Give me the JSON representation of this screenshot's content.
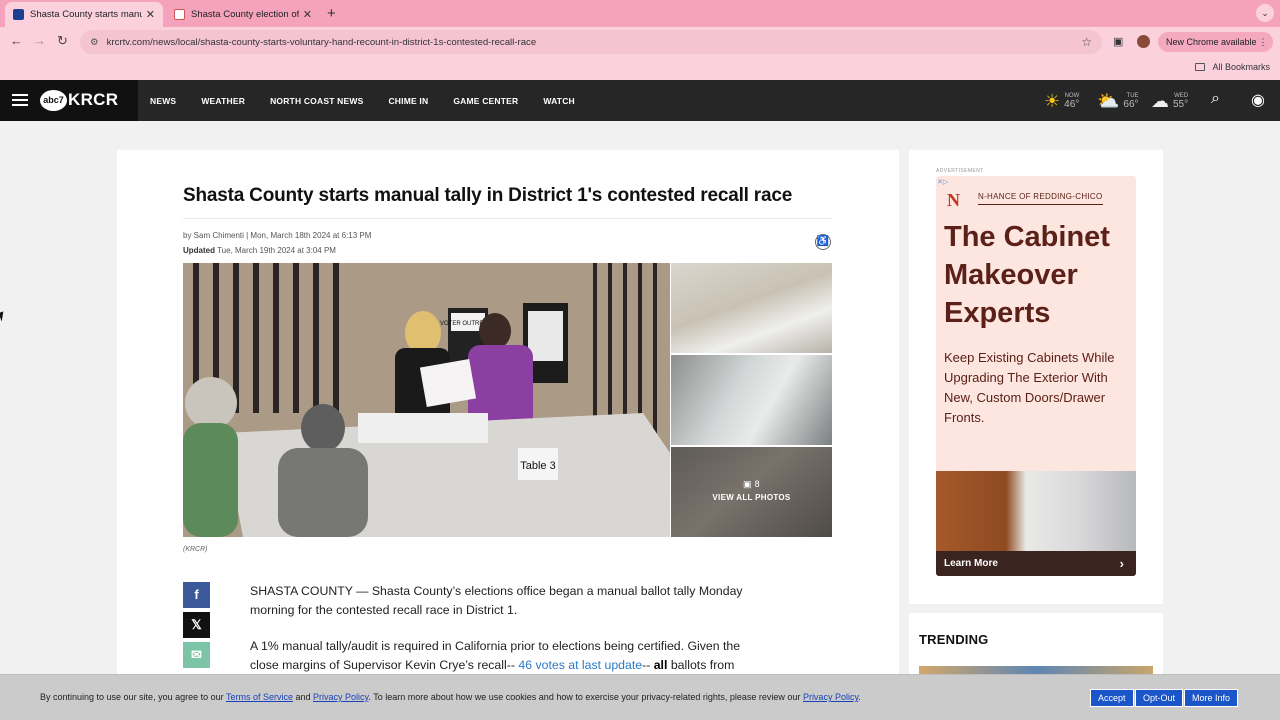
{
  "browser": {
    "tabs": [
      {
        "title": "Shasta County starts manual",
        "active": true
      },
      {
        "title": "Shasta County election offici",
        "active": false
      }
    ],
    "url": "krcrtv.com/news/local/shasta-county-starts-voluntary-hand-recount-in-district-1s-contested-recall-race",
    "new_chrome": "New Chrome available",
    "all_bookmarks": "All Bookmarks"
  },
  "site": {
    "logo_badge": "abc7",
    "logo_text": "KRCR",
    "nav": [
      "NEWS",
      "WEATHER",
      "NORTH COAST NEWS",
      "CHIME IN",
      "GAME CENTER",
      "WATCH"
    ],
    "weather": [
      {
        "label": "NOW",
        "temp": "46°",
        "icon": "sun-icon"
      },
      {
        "label": "TUE",
        "temp": "66°",
        "icon": "partly-cloudy-icon"
      },
      {
        "label": "WED",
        "temp": "55°",
        "icon": "rain-cloud-icon"
      }
    ]
  },
  "article": {
    "headline": "Shasta County starts manual tally in District 1's contested recall race",
    "byline": "by Sam Chimenti | Mon, March 18th 2024 at 6:13 PM",
    "updated_label": "Updated",
    "updated_date": "Tue, March 19th 2024 at 3:04 PM",
    "photo_count": "8",
    "view_all": "VIEW ALL PHOTOS",
    "caption": "(KRCR)",
    "photo_sign_1": "VOTER OUTREACH",
    "photo_sign_2": "Table 3",
    "p1": "SHASTA COUNTY — Shasta County’s elections office began a manual ballot tally Monday morning for the contested recall race in District 1.",
    "p2_a": "A 1% manual tally/audit is required in California prior to elections being certified. Given the close margins of Supervisor Kevin Crye’s recall-- ",
    "p2_link": "46 votes at last update",
    "p2_b": "-- ",
    "p2_bold": "all",
    "p2_c": " ballots from"
  },
  "ad": {
    "label": "ADVERTISEMENT",
    "logo": "N",
    "brand": "N-HANCE OF REDDING-CHICO",
    "title": "The Cabinet Makeover Experts",
    "body": "Keep Existing Cabinets While Upgrading The Exterior With New, Custom Doors/Drawer Fronts.",
    "cta": "Learn More"
  },
  "trending": {
    "title": "TRENDING"
  },
  "cookie": {
    "t1": "By continuing to use our site, you agree to our ",
    "terms": "Terms of Service",
    "t2": " and ",
    "privacy": "Privacy Policy",
    "t3": ". To learn more about how we use cookies and how to exercise your privacy-related rights, please review our ",
    "privacy2": "Privacy Policy",
    "t4": ".",
    "accept": "Accept",
    "optout": "Opt-Out",
    "more": "More Info"
  }
}
